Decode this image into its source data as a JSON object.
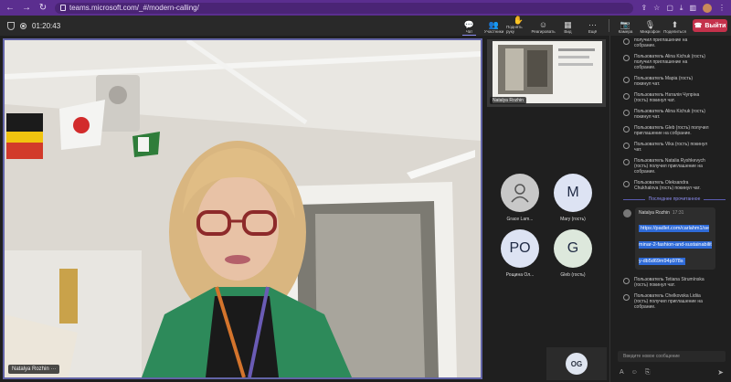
{
  "browser": {
    "url": "teams.microsoft.com/_#/modern-calling/",
    "back_icon": "back-arrow-icon",
    "forward_icon": "forward-arrow-icon",
    "reload_icon": "reload-icon"
  },
  "call": {
    "timer": "01:20:43",
    "tools": [
      {
        "label": "Чат",
        "icon": "chat-icon"
      },
      {
        "label": "Участники",
        "icon": "participants-icon"
      },
      {
        "label": "Поднять руку",
        "icon": "raise-hand-icon"
      },
      {
        "label": "Реагировать",
        "icon": "react-icon"
      },
      {
        "label": "Вид",
        "icon": "view-icon"
      },
      {
        "label": "Ещё",
        "icon": "more-icon"
      },
      {
        "label": "Камера",
        "icon": "camera-icon"
      },
      {
        "label": "Микрофон",
        "icon": "mic-icon"
      },
      {
        "label": "Поделиться",
        "icon": "share-icon"
      }
    ],
    "leave_label": "Выйти",
    "leave_color": "#c4314b",
    "accent": "#6264a7"
  },
  "main_video": {
    "name": "Natalya Rozhin"
  },
  "small_video": {
    "name": "Natalya Rozhin"
  },
  "participants": [
    {
      "initials": "",
      "name": "Grace Lam...",
      "color": "#c8c8c8"
    },
    {
      "initials": "M",
      "name": "Mary (гость)",
      "color": "#dde3f3"
    },
    {
      "initials": "PO",
      "name": "Рощина Ол...",
      "color": "#dde3f3"
    },
    {
      "initials": "G",
      "name": "Gleb (гость)",
      "color": "#dde8dc"
    }
  ],
  "og_tile": {
    "initials": "OG"
  },
  "chat": {
    "events": [
      "получил приглашение на собрание.",
      "Пользователь Alina Kichuk (гость) получил приглашение на собрание.",
      "Пользователь Mapia (гость) покинул чат.",
      "Пользователь Наталія Чупріна (гость) покинул чат.",
      "Пользователь Alina Kichuk (гость) покинул чат.",
      "Пользователь Gleb (гость) получил приглашение на собрание.",
      "Пользователь Vika (гость) покинул чат.",
      "Пользователь Natalia Ryshkevych (гость) получил приглашение на собрание.",
      "Пользователь Oleksandra Chukhalova (гость) покинул чат."
    ],
    "divider": "Последнее прочитанное",
    "message": {
      "author": "Natalya Rozhin",
      "time": "17:31",
      "link": "https://padlet.com/carlahm1/seminar-2-fashion-and-sustainability-db5d69m94p978s"
    },
    "events_after": [
      "Пользователь Tetiana Strumínska (гость) покинул чат.",
      "Пользователь Chelkovska Lidiia (гость) получил приглашение на собрание."
    ],
    "compose_placeholder": "Введите новое сообщение"
  }
}
